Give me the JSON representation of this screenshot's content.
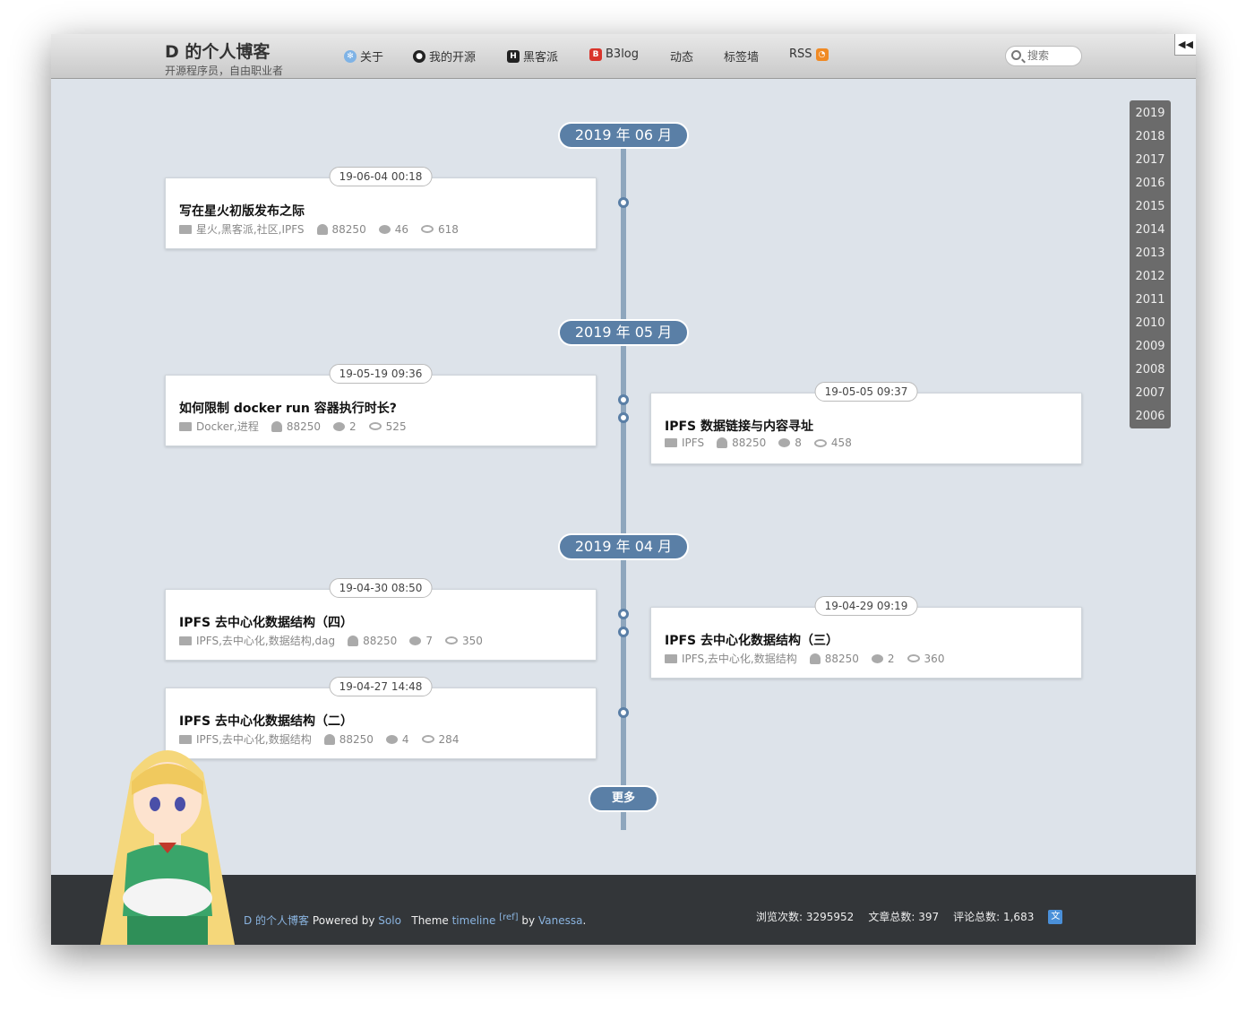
{
  "header": {
    "title": "D 的个人博客",
    "subtitle": "开源程序员，自由职业者",
    "nav": [
      {
        "label": "关于",
        "icon": "snowflake-icon"
      },
      {
        "label": "我的开源",
        "icon": "github-icon"
      },
      {
        "label": "黑客派",
        "icon": "hacpai-icon"
      },
      {
        "label": "B3log",
        "icon": "b3log-icon"
      },
      {
        "label": "动态",
        "icon": ""
      },
      {
        "label": "标签墙",
        "icon": ""
      },
      {
        "label": "RSS",
        "icon": "rss-icon"
      }
    ],
    "search_placeholder": "搜索"
  },
  "timeline": {
    "months": [
      "2019 年 06 月",
      "2019 年 05 月",
      "2019 年 04 月"
    ],
    "posts": [
      {
        "date": "19-06-04 00:18",
        "title": "写在星火初版发布之际",
        "tags": "星火,黑客派,社区,IPFS",
        "author": "88250",
        "comments": "46",
        "views": "618"
      },
      {
        "date": "19-05-19 09:36",
        "title": "如何限制 docker run 容器执行时长?",
        "tags": "Docker,进程",
        "author": "88250",
        "comments": "2",
        "views": "525"
      },
      {
        "date": "19-05-05 09:37",
        "title": "IPFS 数据链接与内容寻址",
        "tags": "IPFS",
        "author": "88250",
        "comments": "8",
        "views": "458"
      },
      {
        "date": "19-04-30 08:50",
        "title": "IPFS 去中心化数据结构（四）",
        "tags": "IPFS,去中心化,数据结构,dag",
        "author": "88250",
        "comments": "7",
        "views": "350"
      },
      {
        "date": "19-04-29 09:19",
        "title": "IPFS 去中心化数据结构（三）",
        "tags": "IPFS,去中心化,数据结构",
        "author": "88250",
        "comments": "2",
        "views": "360"
      },
      {
        "date": "19-04-27 14:48",
        "title": "IPFS 去中心化数据结构（二）",
        "tags": "IPFS,去中心化,数据结构",
        "author": "88250",
        "comments": "4",
        "views": "284"
      }
    ],
    "more_label": "更多"
  },
  "years": [
    "2019",
    "2018",
    "2017",
    "2016",
    "2015",
    "2014",
    "2013",
    "2012",
    "2011",
    "2010",
    "2009",
    "2008",
    "2007",
    "2006"
  ],
  "footer": {
    "prefix": "D 的个人博客",
    "powered": "Powered by",
    "solo": "Solo",
    "theme": "Theme",
    "theme_name": "timeline",
    "ref": "[ref]",
    "by": "by",
    "author": "Vanessa",
    "end": ".",
    "views_label": "浏览次数:",
    "views_value": "3295952",
    "articles_label": "文章总数:",
    "articles_value": "397",
    "comments_label": "评论总数:",
    "comments_value": "1,683"
  },
  "colors": {
    "accent": "#5a7fa6",
    "background": "#dde3ea",
    "footer": "#333639"
  }
}
